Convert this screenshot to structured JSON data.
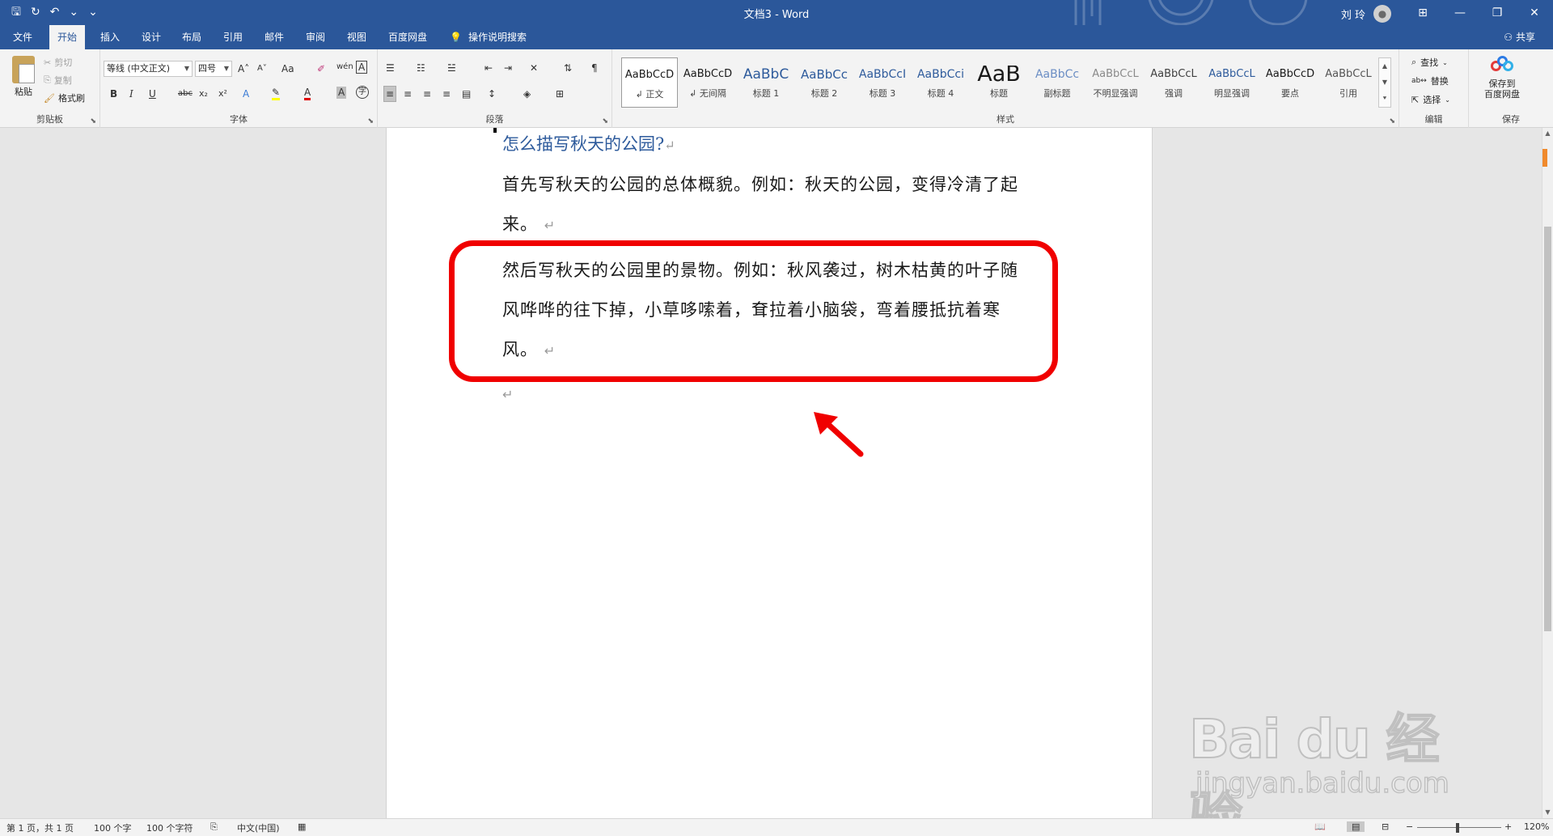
{
  "titlebar": {
    "title": "文档3  -  Word",
    "user_name": "刘 玲",
    "qat": {
      "save": "🖫",
      "redo": "↻",
      "undo": "↶",
      "undo_menu": "⌄",
      "customize": "⌄"
    },
    "window": {
      "ribbon_display": "⊞",
      "minimize": "—",
      "maximize": "❐",
      "close": "✕"
    }
  },
  "tabs": [
    {
      "label": "文件",
      "active": false
    },
    {
      "label": "开始",
      "active": true
    },
    {
      "label": "插入",
      "active": false
    },
    {
      "label": "设计",
      "active": false
    },
    {
      "label": "布局",
      "active": false
    },
    {
      "label": "引用",
      "active": false
    },
    {
      "label": "邮件",
      "active": false
    },
    {
      "label": "审阅",
      "active": false
    },
    {
      "label": "视图",
      "active": false
    },
    {
      "label": "百度网盘",
      "active": false
    }
  ],
  "tell_me": "操作说明搜索",
  "share": "共享",
  "ribbon": {
    "clipboard": {
      "label": "剪贴板",
      "paste": "粘贴",
      "cut": "剪切",
      "copy": "复制",
      "format_painter": "格式刷"
    },
    "font": {
      "label": "字体",
      "font_name": "等线 (中文正文)",
      "font_size": "四号",
      "grow": "A˄",
      "shrink": "A˅",
      "change_case": "Aa",
      "bold": "B",
      "italic": "I",
      "underline": "U",
      "strike": "abc",
      "subscript": "x₂",
      "superscript": "x²"
    },
    "paragraph": {
      "label": "段落"
    },
    "styles": {
      "label": "样式",
      "items": [
        {
          "sample": "AaBbCcD",
          "name": "↲ 正文",
          "color": "#1a1a1a",
          "size": "13px",
          "selected": true
        },
        {
          "sample": "AaBbCcD",
          "name": "↲ 无间隔",
          "color": "#1a1a1a",
          "size": "13px",
          "selected": false
        },
        {
          "sample": "AaBbC",
          "name": "标题 1",
          "color": "#2e5b9c",
          "size": "17px",
          "selected": false
        },
        {
          "sample": "AaBbCc",
          "name": "标题 2",
          "color": "#2e5b9c",
          "size": "15px",
          "selected": false
        },
        {
          "sample": "AaBbCcI",
          "name": "标题 3",
          "color": "#2e5b9c",
          "size": "14px",
          "selected": false
        },
        {
          "sample": "AaBbCci",
          "name": "标题 4",
          "color": "#2e5b9c",
          "size": "14px",
          "selected": false
        },
        {
          "sample": "AaB",
          "name": "标题",
          "color": "#1a1a1a",
          "size": "27px",
          "selected": false
        },
        {
          "sample": "AaBbCc",
          "name": "副标题",
          "color": "#6b8ec4",
          "size": "14px",
          "selected": false
        },
        {
          "sample": "AaBbCcL",
          "name": "不明显强调",
          "color": "#8a8a8a",
          "size": "13px",
          "selected": false
        },
        {
          "sample": "AaBbCcL",
          "name": "强调",
          "color": "#404040",
          "size": "13px",
          "selected": false
        },
        {
          "sample": "AaBbCcL",
          "name": "明显强调",
          "color": "#2e5b9c",
          "size": "13px",
          "selected": false
        },
        {
          "sample": "AaBbCcD",
          "name": "要点",
          "color": "#1a1a1a",
          "size": "13px",
          "selected": false
        },
        {
          "sample": "AaBbCcL",
          "name": "引用",
          "color": "#555555",
          "size": "13px",
          "selected": false
        }
      ]
    },
    "editing": {
      "label": "编辑",
      "find": "查找",
      "replace": "替换",
      "select": "选择"
    },
    "save": {
      "label": "保存",
      "button_line1": "保存到",
      "button_line2": "百度网盘"
    }
  },
  "document": {
    "heading": "怎么描写秋天的公园?",
    "para1_line1": "首先写秋天的公园的总体概貌。例如：秋天的公园，变得冷清了起",
    "para1_line2": "来。",
    "para2_line1": "然后写秋天的公园里的景物。例如：秋风袭过，树木枯黄的叶子随",
    "para2_line2": "风哗哗的往下掉，小草哆嗦着，耷拉着小脑袋，弯着腰抵抗着寒",
    "para2_line3": "风。",
    "para_mark": "↵"
  },
  "statusbar": {
    "page": "第 1 页，共 1 页",
    "words": "100 个字",
    "chars": "100 个字符",
    "language": "中文(中国)",
    "zoom_minus": "−",
    "zoom_plus": "+",
    "zoom": "120%",
    "zoom_level": 120
  },
  "watermark": {
    "brand": "Bai du 经验",
    "url": "jingyan.baidu.com"
  },
  "colors": {
    "accent": "#2b579a",
    "highlight_border": "#f00000",
    "heading": "#2e5b9c"
  }
}
